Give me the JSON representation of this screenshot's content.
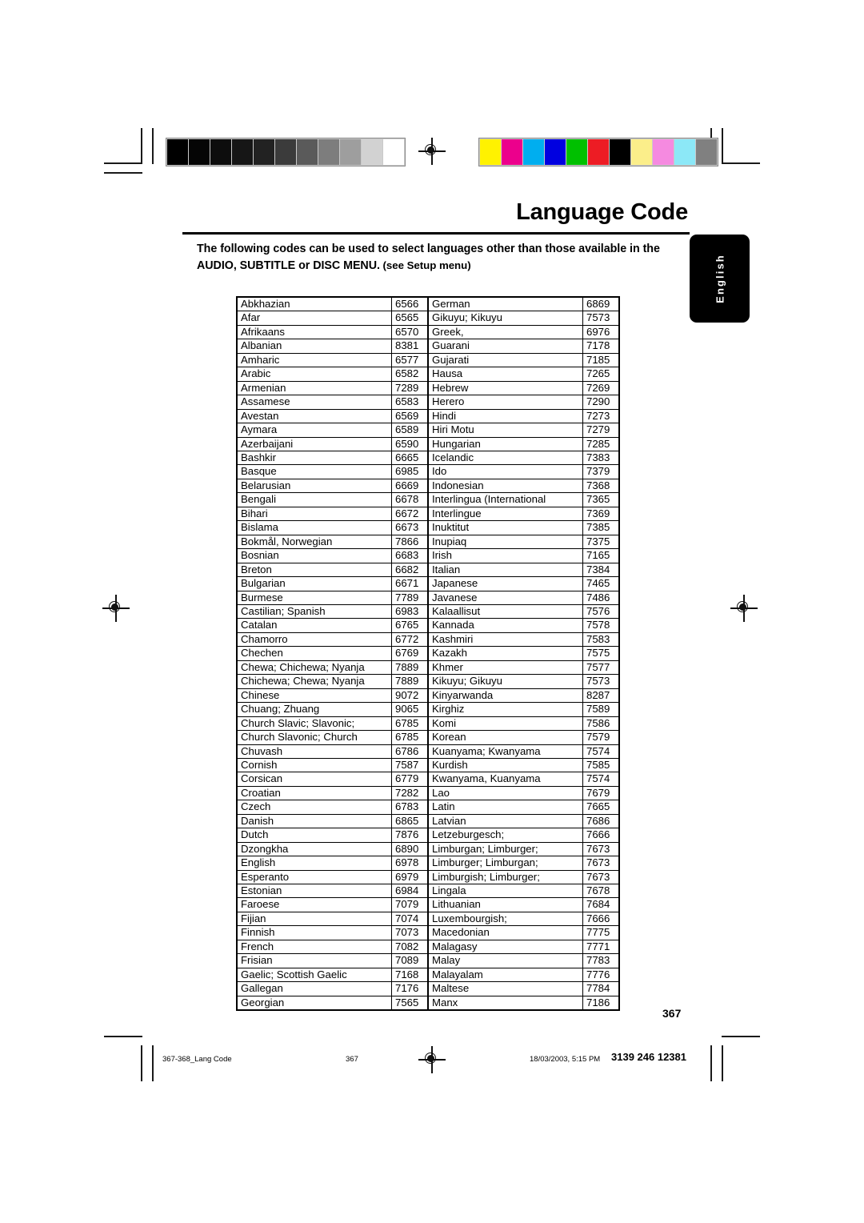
{
  "header": {
    "title": "Language Code",
    "intro_line1": "The following codes can be used to select languages other than those available in the",
    "intro_line2_bold": "AUDIO, SUBTITLE",
    "intro_line2_mid": " or ",
    "intro_line2_bold2": "DISC MENU.",
    "intro_line2_note": " (see Setup menu)"
  },
  "side_tab": {
    "label": "English"
  },
  "table": {
    "left": [
      {
        "name": "Abkhazian",
        "code": "6566"
      },
      {
        "name": "Afar",
        "code": "6565"
      },
      {
        "name": "Afrikaans",
        "code": "6570"
      },
      {
        "name": "Albanian",
        "code": "8381"
      },
      {
        "name": "Amharic",
        "code": "6577"
      },
      {
        "name": "Arabic",
        "code": "6582"
      },
      {
        "name": "Armenian",
        "code": "7289"
      },
      {
        "name": "Assamese",
        "code": "6583"
      },
      {
        "name": "Avestan",
        "code": "6569"
      },
      {
        "name": "Aymara",
        "code": "6589"
      },
      {
        "name": "Azerbaijani",
        "code": "6590"
      },
      {
        "name": "Bashkir",
        "code": "6665"
      },
      {
        "name": "Basque",
        "code": "6985"
      },
      {
        "name": "Belarusian",
        "code": "6669"
      },
      {
        "name": "Bengali",
        "code": "6678"
      },
      {
        "name": "Bihari",
        "code": "6672"
      },
      {
        "name": "Bislama",
        "code": "6673"
      },
      {
        "name": "Bokmål, Norwegian",
        "code": "7866"
      },
      {
        "name": "Bosnian",
        "code": "6683"
      },
      {
        "name": "Breton",
        "code": "6682"
      },
      {
        "name": "Bulgarian",
        "code": "6671"
      },
      {
        "name": "Burmese",
        "code": "7789"
      },
      {
        "name": "Castilian; Spanish",
        "code": "6983"
      },
      {
        "name": "Catalan",
        "code": "6765"
      },
      {
        "name": "Chamorro",
        "code": "6772"
      },
      {
        "name": "Chechen",
        "code": "6769"
      },
      {
        "name": "Chewa; Chichewa; Nyanja",
        "code": "7889"
      },
      {
        "name": "Chichewa; Chewa; Nyanja",
        "code": "7889"
      },
      {
        "name": "Chinese",
        "code": "9072"
      },
      {
        "name": "Chuang; Zhuang",
        "code": "9065"
      },
      {
        "name": "Church Slavic; Slavonic;",
        "code": "6785"
      },
      {
        "name": "Church Slavonic; Church",
        "code": "6785"
      },
      {
        "name": "Chuvash",
        "code": "6786"
      },
      {
        "name": "Cornish",
        "code": "7587"
      },
      {
        "name": "Corsican",
        "code": "6779"
      },
      {
        "name": "Croatian",
        "code": "7282"
      },
      {
        "name": "Czech",
        "code": "6783"
      },
      {
        "name": "Danish",
        "code": "6865"
      },
      {
        "name": "Dutch",
        "code": "7876"
      },
      {
        "name": "Dzongkha",
        "code": "6890"
      },
      {
        "name": "English",
        "code": "6978"
      },
      {
        "name": "Esperanto",
        "code": "6979"
      },
      {
        "name": "Estonian",
        "code": "6984"
      },
      {
        "name": "Faroese",
        "code": "7079"
      },
      {
        "name": "Fijian",
        "code": "7074"
      },
      {
        "name": "Finnish",
        "code": "7073"
      },
      {
        "name": "French",
        "code": "7082"
      },
      {
        "name": "Frisian",
        "code": "7089"
      },
      {
        "name": "Gaelic; Scottish Gaelic",
        "code": "7168"
      },
      {
        "name": "Gallegan",
        "code": "7176"
      },
      {
        "name": "Georgian",
        "code": "7565"
      }
    ],
    "right": [
      {
        "name": "German",
        "code": "6869"
      },
      {
        "name": "Gikuyu; Kikuyu",
        "code": "7573"
      },
      {
        "name": "Greek,",
        "code": "6976"
      },
      {
        "name": "Guarani",
        "code": "7178"
      },
      {
        "name": "Gujarati",
        "code": "7185"
      },
      {
        "name": "Hausa",
        "code": "7265"
      },
      {
        "name": "Hebrew",
        "code": "7269"
      },
      {
        "name": "Herero",
        "code": "7290"
      },
      {
        "name": "Hindi",
        "code": "7273"
      },
      {
        "name": "Hiri Motu",
        "code": "7279"
      },
      {
        "name": "Hungarian",
        "code": "7285"
      },
      {
        "name": "Icelandic",
        "code": "7383"
      },
      {
        "name": "Ido",
        "code": "7379"
      },
      {
        "name": "Indonesian",
        "code": "7368"
      },
      {
        "name": "Interlingua (International",
        "code": "7365"
      },
      {
        "name": "Interlingue",
        "code": "7369"
      },
      {
        "name": "Inuktitut",
        "code": "7385"
      },
      {
        "name": "Inupiaq",
        "code": "7375"
      },
      {
        "name": "Irish",
        "code": "7165"
      },
      {
        "name": "Italian",
        "code": "7384"
      },
      {
        "name": "Japanese",
        "code": "7465"
      },
      {
        "name": "Javanese",
        "code": "7486"
      },
      {
        "name": "Kalaallisut",
        "code": "7576"
      },
      {
        "name": "Kannada",
        "code": "7578"
      },
      {
        "name": "Kashmiri",
        "code": "7583"
      },
      {
        "name": "Kazakh",
        "code": "7575"
      },
      {
        "name": "Khmer",
        "code": "7577"
      },
      {
        "name": "Kikuyu; Gikuyu",
        "code": "7573"
      },
      {
        "name": "Kinyarwanda",
        "code": "8287"
      },
      {
        "name": "Kirghiz",
        "code": "7589"
      },
      {
        "name": "Komi",
        "code": "7586"
      },
      {
        "name": "Korean",
        "code": "7579"
      },
      {
        "name": "Kuanyama; Kwanyama",
        "code": "7574"
      },
      {
        "name": "Kurdish",
        "code": "7585"
      },
      {
        "name": "Kwanyama, Kuanyama",
        "code": "7574"
      },
      {
        "name": "Lao",
        "code": "7679"
      },
      {
        "name": "Latin",
        "code": "7665"
      },
      {
        "name": "Latvian",
        "code": "7686"
      },
      {
        "name": "Letzeburgesch;",
        "code": "7666"
      },
      {
        "name": "Limburgan; Limburger;",
        "code": "7673"
      },
      {
        "name": "Limburger; Limburgan;",
        "code": "7673"
      },
      {
        "name": "Limburgish; Limburger;",
        "code": "7673"
      },
      {
        "name": "Lingala",
        "code": "7678"
      },
      {
        "name": "Lithuanian",
        "code": "7684"
      },
      {
        "name": "Luxembourgish;",
        "code": "7666"
      },
      {
        "name": "Macedonian",
        "code": "7775"
      },
      {
        "name": "Malagasy",
        "code": "7771"
      },
      {
        "name": "Malay",
        "code": "7783"
      },
      {
        "name": "Malayalam",
        "code": "7776"
      },
      {
        "name": "Maltese",
        "code": "7784"
      },
      {
        "name": "Manx",
        "code": "7186"
      }
    ]
  },
  "page_number": "367",
  "footer": {
    "file_slug": "367-368_Lang Code",
    "page": "367",
    "date": "18/03/2003, 5:15 PM",
    "part_number": "3139 246 12381"
  },
  "calibration": {
    "grayscale": [
      "#000000",
      "#050505",
      "#0d0d0d",
      "#161616",
      "#222222",
      "#3b3b3b",
      "#5a5a5a",
      "#7d7d7d",
      "#9e9e9e",
      "#d2d2d2",
      "#ffffff"
    ],
    "colors": [
      "#fff200",
      "#ec008c",
      "#00aeef",
      "#0000e0",
      "#00c000",
      "#ed1c24",
      "#000000",
      "#fbee8a",
      "#f58ae0",
      "#8ce8f7",
      "#808080"
    ]
  }
}
